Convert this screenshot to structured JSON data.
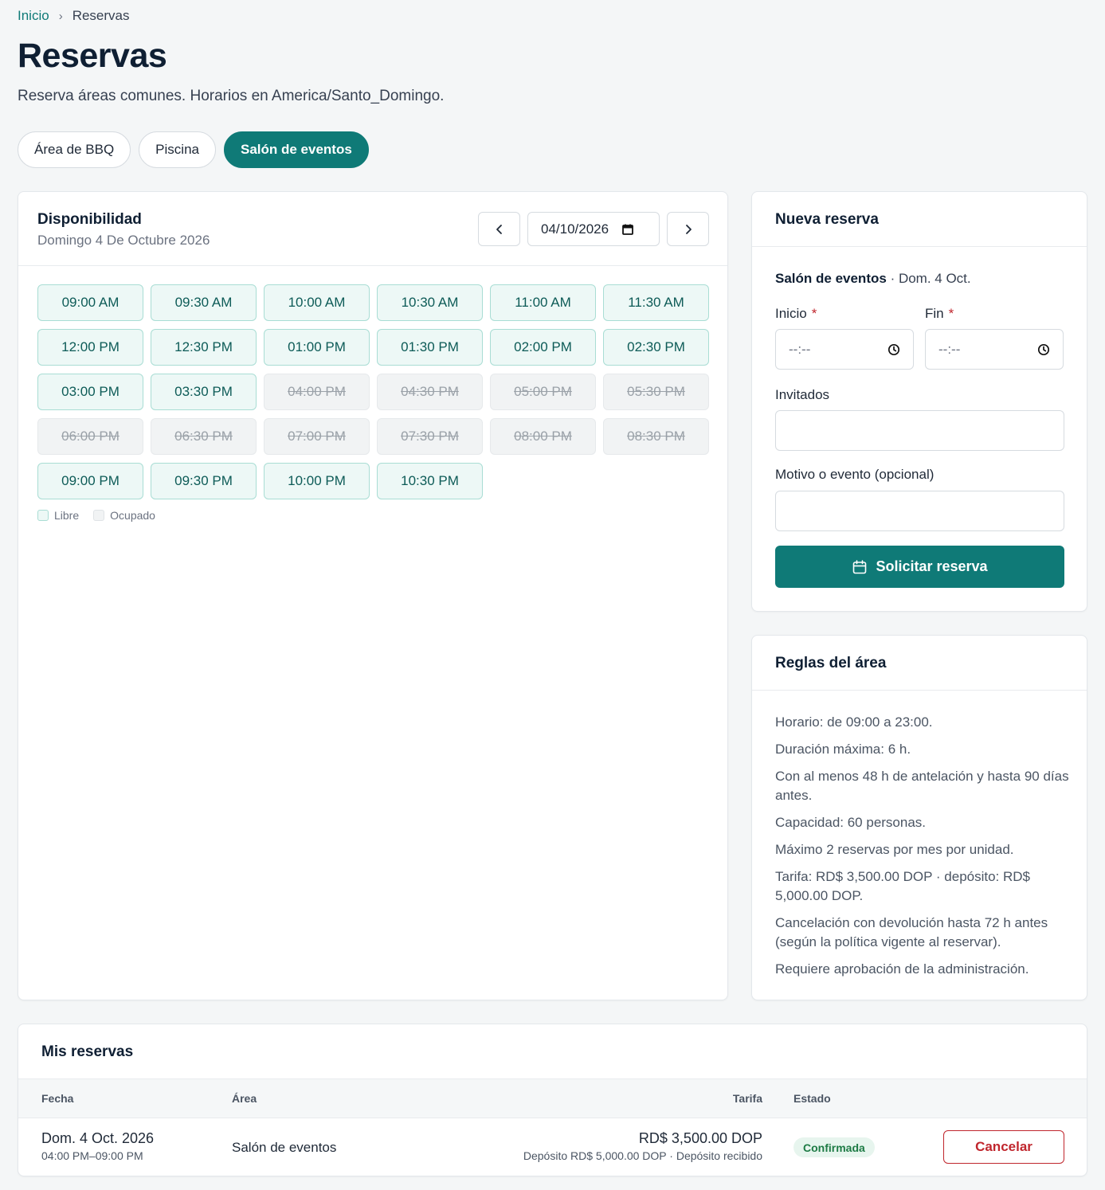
{
  "breadcrumb": {
    "home": "Inicio",
    "separator": "›",
    "current": "Reservas"
  },
  "page": {
    "title": "Reservas",
    "subtitle": "Reserva áreas comunes. Horarios en America/Santo_Domingo."
  },
  "area_tabs": [
    {
      "label": "Área de BBQ",
      "active": false
    },
    {
      "label": "Piscina",
      "active": false
    },
    {
      "label": "Salón de eventos",
      "active": true
    }
  ],
  "availability": {
    "title": "Disponibilidad",
    "date_label": "Domingo 4 De Octubre 2026",
    "date_value": "04/10/2026",
    "slots": [
      {
        "time": "09:00 AM",
        "status": "free"
      },
      {
        "time": "09:30 AM",
        "status": "free"
      },
      {
        "time": "10:00 AM",
        "status": "free"
      },
      {
        "time": "10:30 AM",
        "status": "free"
      },
      {
        "time": "11:00 AM",
        "status": "free"
      },
      {
        "time": "11:30 AM",
        "status": "free"
      },
      {
        "time": "12:00 PM",
        "status": "free"
      },
      {
        "time": "12:30 PM",
        "status": "free"
      },
      {
        "time": "01:00 PM",
        "status": "free"
      },
      {
        "time": "01:30 PM",
        "status": "free"
      },
      {
        "time": "02:00 PM",
        "status": "free"
      },
      {
        "time": "02:30 PM",
        "status": "free"
      },
      {
        "time": "03:00 PM",
        "status": "free"
      },
      {
        "time": "03:30 PM",
        "status": "free"
      },
      {
        "time": "04:00 PM",
        "status": "busy"
      },
      {
        "time": "04:30 PM",
        "status": "busy"
      },
      {
        "time": "05:00 PM",
        "status": "busy"
      },
      {
        "time": "05:30 PM",
        "status": "busy"
      },
      {
        "time": "06:00 PM",
        "status": "busy"
      },
      {
        "time": "06:30 PM",
        "status": "busy"
      },
      {
        "time": "07:00 PM",
        "status": "busy"
      },
      {
        "time": "07:30 PM",
        "status": "busy"
      },
      {
        "time": "08:00 PM",
        "status": "busy"
      },
      {
        "time": "08:30 PM",
        "status": "busy"
      },
      {
        "time": "09:00 PM",
        "status": "free"
      },
      {
        "time": "09:30 PM",
        "status": "free"
      },
      {
        "time": "10:00 PM",
        "status": "free"
      },
      {
        "time": "10:30 PM",
        "status": "free"
      }
    ],
    "legend": {
      "free": "Libre",
      "busy": "Ocupado"
    }
  },
  "booking_form": {
    "title": "Nueva reserva",
    "context_area": "Salón de eventos",
    "context_date": "· Dom. 4 Oct.",
    "start_label": "Inicio",
    "end_label": "Fin",
    "required_mark": "*",
    "start_value": "--:--",
    "end_value": "--:--",
    "guests_label": "Invitados",
    "guests_value": "",
    "reason_label": "Motivo o evento (opcional)",
    "reason_value": "",
    "submit_label": "Solicitar reserva"
  },
  "rules": {
    "title": "Reglas del área",
    "items": [
      "Horario: de 09:00 a 23:00.",
      "Duración máxima: 6 h.",
      "Con al menos 48 h de antelación y hasta 90 días antes.",
      "Capacidad: 60 personas.",
      "Máximo 2 reservas por mes por unidad.",
      "Tarifa: RD$ 3,500.00 DOP · depósito: RD$ 5,000.00 DOP.",
      "Cancelación con devolución hasta 72 h antes (según la política vigente al reservar).",
      "Requiere aprobación de la administración."
    ]
  },
  "my_bookings": {
    "title": "Mis reservas",
    "columns": {
      "date": "Fecha",
      "area": "Área",
      "fee": "Tarifa",
      "status": "Estado"
    },
    "rows": [
      {
        "date": "Dom. 4 Oct. 2026",
        "time": "04:00 PM–09:00 PM",
        "area": "Salón de eventos",
        "fee": "RD$ 3,500.00 DOP",
        "deposit": "Depósito RD$ 5,000.00 DOP · Depósito recibido",
        "status": "Confirmada",
        "action": "Cancelar"
      }
    ]
  },
  "colors": {
    "accent": "#0f7a77",
    "danger": "#c0262d",
    "success_bg": "#e7f5ee",
    "success_text": "#1e7b45"
  },
  "icons": [
    "chevron-left-icon",
    "chevron-right-icon",
    "calendar-icon",
    "clock-icon",
    "breadcrumb-chevron-icon"
  ]
}
